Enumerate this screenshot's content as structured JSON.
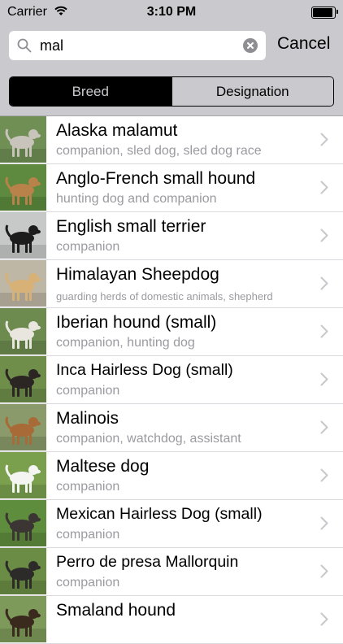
{
  "status_bar": {
    "carrier": "Carrier",
    "time": "3:10 PM",
    "battery_level": 1.0
  },
  "search": {
    "query": "mal",
    "cancel_label": "Cancel"
  },
  "segments": [
    {
      "label": "Breed",
      "selected": true
    },
    {
      "label": "Designation",
      "selected": false
    }
  ],
  "breeds": [
    {
      "name": "Alaska malamut",
      "designation": "companion, sled dog, sled dog race",
      "photo": {
        "background": "#6f8f55",
        "dog": "#c8c3bb"
      }
    },
    {
      "name": "Anglo-French small hound",
      "designation": "hunting dog and companion",
      "photo": {
        "background": "#5d8a3e",
        "dog": "#b9824a"
      }
    },
    {
      "name": "English small terrier",
      "designation": "companion",
      "photo": {
        "background": "#c7c9c9",
        "dog": "#1c1c1c"
      }
    },
    {
      "name": "Himalayan Sheepdog",
      "designation": "guarding herds of domestic animals, shepherd",
      "photo": {
        "background": "#bfb7a6",
        "dog": "#d8b176"
      }
    },
    {
      "name": "Iberian hound (small)",
      "designation": "companion, hunting dog",
      "photo": {
        "background": "#6d8b4e",
        "dog": "#e9e6e0"
      }
    },
    {
      "name": "Inca Hairless Dog (small)",
      "designation": "companion",
      "photo": {
        "background": "#6e8e4a",
        "dog": "#2b2624"
      }
    },
    {
      "name": "Malinois",
      "designation": "companion, watchdog, assistant",
      "photo": {
        "background": "#8a9a6a",
        "dog": "#a86a36"
      }
    },
    {
      "name": "Maltese dog",
      "designation": "companion",
      "photo": {
        "background": "#7aa04e",
        "dog": "#f4f4f2"
      }
    },
    {
      "name": "Mexican Hairless Dog (small)",
      "designation": "companion",
      "photo": {
        "background": "#5f8d3e",
        "dog": "#3b3533"
      }
    },
    {
      "name": "Perro de presa Mallorquin",
      "designation": "companion",
      "photo": {
        "background": "#6a8c44",
        "dog": "#2d2b2a"
      }
    },
    {
      "name": "Smaland hound",
      "designation": "",
      "photo": {
        "background": "#7d9a5a",
        "dog": "#3a2a1e"
      }
    }
  ]
}
